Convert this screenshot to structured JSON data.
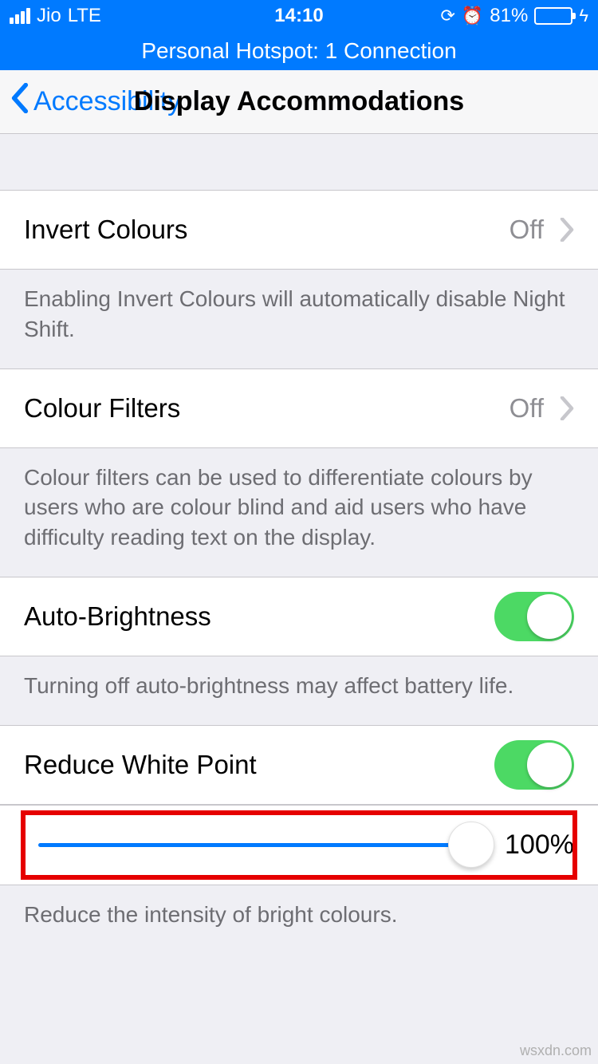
{
  "status_bar": {
    "carrier": "Jio",
    "network": "LTE",
    "time": "14:10",
    "battery_percent": "81%"
  },
  "hotspot": {
    "text": "Personal Hotspot: 1 Connection"
  },
  "nav": {
    "back_label": "Accessibility",
    "title": "Display Accommodations"
  },
  "rows": {
    "invert_colours": {
      "label": "Invert Colours",
      "value": "Off"
    },
    "invert_colours_footer": "Enabling Invert Colours will automatically disable Night Shift.",
    "colour_filters": {
      "label": "Colour Filters",
      "value": "Off"
    },
    "colour_filters_footer": "Colour filters can be used to differentiate colours by users who are colour blind and aid users who have difficulty reading text on the display.",
    "auto_brightness": {
      "label": "Auto-Brightness",
      "on": true
    },
    "auto_brightness_footer": "Turning off auto-brightness may affect battery life.",
    "reduce_white_point": {
      "label": "Reduce White Point",
      "on": true
    },
    "reduce_white_point_value": "100%",
    "reduce_white_point_footer": "Reduce the intensity of bright colours."
  },
  "watermark": "wsxdn.com"
}
